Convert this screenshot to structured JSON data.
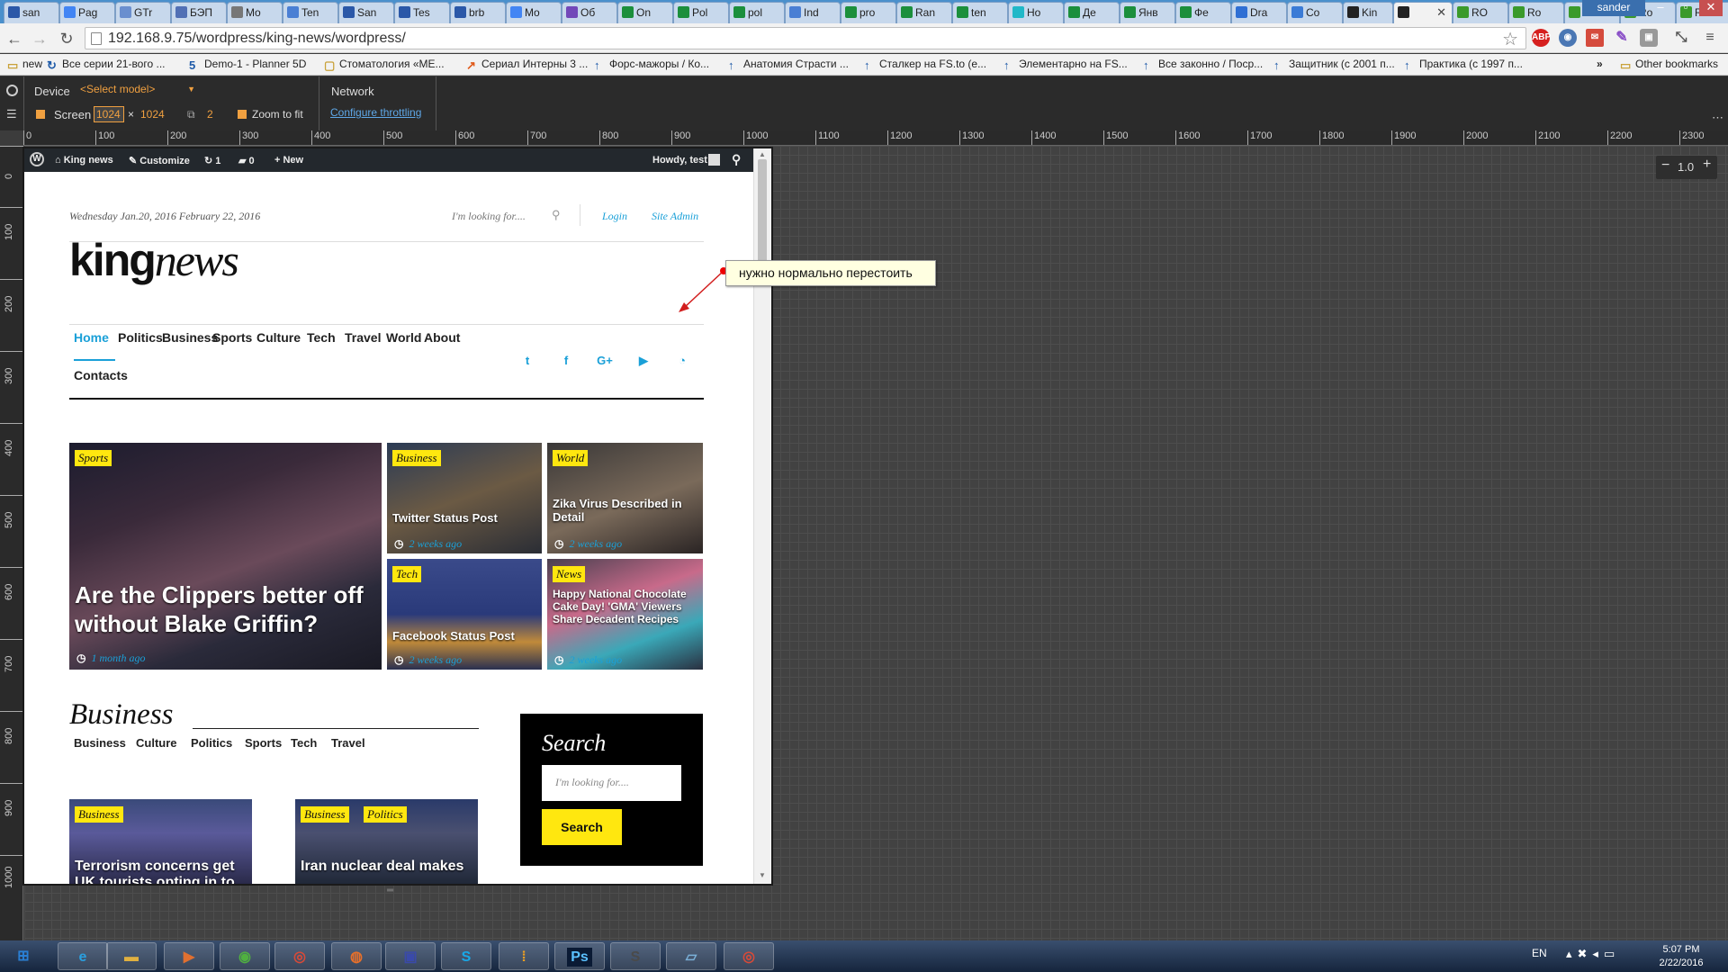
{
  "browser": {
    "tabs": [
      {
        "label": "san",
        "icon": "x-icon"
      },
      {
        "label": "Pag",
        "icon": "g-icon"
      },
      {
        "label": "GTr",
        "icon": "gt-icon"
      },
      {
        "label": "БЭП",
        "icon": "b-icon"
      },
      {
        "label": "Mo",
        "icon": "w-icon"
      },
      {
        "label": "Ten",
        "icon": "doc-icon"
      },
      {
        "label": "San",
        "icon": "x-icon"
      },
      {
        "label": "Tes",
        "icon": "x-icon"
      },
      {
        "label": "brb",
        "icon": "x-icon"
      },
      {
        "label": "Mo",
        "icon": "g-icon"
      },
      {
        "label": "Об",
        "icon": "forms-icon"
      },
      {
        "label": "On",
        "icon": "sheets-icon"
      },
      {
        "label": "Pol",
        "icon": "sheets-icon"
      },
      {
        "label": "pol",
        "icon": "sheets-icon"
      },
      {
        "label": "Ind",
        "icon": "doc-icon"
      },
      {
        "label": "pro",
        "icon": "sheets-icon"
      },
      {
        "label": "Ran",
        "icon": "sheets-icon"
      },
      {
        "label": "ten",
        "icon": "sheets-icon"
      },
      {
        "label": "Ho",
        "icon": "teal-icon"
      },
      {
        "label": "Де",
        "icon": "sheets-icon"
      },
      {
        "label": "Янв",
        "icon": "sheets-icon"
      },
      {
        "label": "Фе",
        "icon": "sheets-icon"
      },
      {
        "label": "Dra",
        "icon": "slides-icon"
      },
      {
        "label": "Co",
        "icon": "q-icon"
      },
      {
        "label": "Kin",
        "icon": "wp-icon"
      },
      {
        "label": "",
        "icon": "wp-icon",
        "active": true
      },
      {
        "label": "RO",
        "icon": "frog-icon"
      },
      {
        "label": "Ro",
        "icon": "frog-icon"
      },
      {
        "label": "Ro",
        "icon": "frog-icon"
      },
      {
        "label": "Ro",
        "icon": "frog-icon"
      },
      {
        "label": "Ro",
        "icon": "frog-icon"
      },
      {
        "label": "Ro",
        "icon": "frog-icon"
      }
    ],
    "user": "sander",
    "url": "192.168.9.75/wordpress/king-news/wordpress/",
    "extensions": [
      "abp-icon",
      "globe-icon",
      "gmail-icon",
      "pen-icon",
      "puzzle-icon",
      "resize-icon",
      "menu-icon"
    ],
    "gmail_badge": "34",
    "bookmarks": [
      {
        "label": "new",
        "icon": "folder-icon"
      },
      {
        "label": "Все серии 21-вого ...",
        "icon": "refresh-icon"
      },
      {
        "label": "Demo-1 - Planner 5D",
        "icon": "5d-icon"
      },
      {
        "label": "Стоматология «МЕ...",
        "icon": "page-icon"
      },
      {
        "label": "Сериал Интерны 3 ...",
        "icon": "rocket-icon"
      },
      {
        "label": "Форс-мажоры / Ко...",
        "icon": "arrow-up-icon"
      },
      {
        "label": "Анатомия Страсти ...",
        "icon": "arrow-up-icon"
      },
      {
        "label": "Сталкер на FS.to (e...",
        "icon": "arrow-up-icon"
      },
      {
        "label": "Элементарно на FS...",
        "icon": "arrow-up-icon"
      },
      {
        "label": "Все законно / Поср...",
        "icon": "arrow-up-icon"
      },
      {
        "label": "Защитник (с 2001 п...",
        "icon": "arrow-up-icon"
      },
      {
        "label": "Практика (с 1997 п...",
        "icon": "arrow-up-icon"
      }
    ],
    "bookmarks_more": "»",
    "other_bookmarks": "Other bookmarks"
  },
  "devtools": {
    "device_label": "Device",
    "model_select": "<Select model>",
    "screen_label": "Screen",
    "screen_width": "1024",
    "screen_height": "1024",
    "times": "×",
    "dpr": "2",
    "zoom_to_fit": "Zoom to fit",
    "network_label": "Network",
    "throttling_link": "Configure throttling",
    "zoom_value": "1.0",
    "hruler_ticks": [
      "0",
      "100",
      "200",
      "300",
      "400",
      "500",
      "600",
      "700",
      "800",
      "900",
      "1000",
      "1100",
      "1200",
      "1300",
      "1400",
      "1500",
      "1600",
      "1700",
      "1800",
      "1900",
      "2000",
      "2100",
      "2200",
      "2300"
    ],
    "vruler_ticks": [
      "0",
      "100",
      "200",
      "300",
      "400",
      "500",
      "600",
      "700",
      "800",
      "900",
      "1000"
    ]
  },
  "wp_admin_bar": {
    "site": "King news",
    "customize": "Customize",
    "updates": "1",
    "comments": "0",
    "new": "New",
    "howdy": "Howdy, test"
  },
  "site": {
    "date": "Wednesday Jan.20, 2016 February 22, 2016",
    "search_placeholder": "I'm looking for....",
    "login": "Login",
    "site_admin": "Site Admin",
    "logo_bold": "king",
    "logo_italic": "news",
    "nav": [
      "Home",
      "Politics",
      "Business",
      "Sports",
      "Culture",
      "Tech",
      "Travel",
      "World",
      "About",
      "Contacts"
    ],
    "social": [
      "twitter-icon",
      "facebook-icon",
      "google-plus-icon",
      "youtube-icon",
      "rss-icon"
    ],
    "featured": [
      {
        "cat": "Sports",
        "title": "Are the Clippers better off without Blake Griffin?",
        "time": "1 month ago"
      },
      {
        "cat": "Business",
        "title": "Twitter Status Post",
        "time": "2 weeks ago"
      },
      {
        "cat": "World",
        "title": "Zika Virus Described in Detail",
        "time": "2 weeks ago"
      },
      {
        "cat": "Tech",
        "title": "Facebook Status Post",
        "time": "2 weeks ago"
      },
      {
        "cat": "News",
        "title": "Happy National Chocolate Cake Day! 'GMA' Viewers Share Decadent Recipes",
        "time": "2 weeks ago"
      }
    ],
    "section_title": "Business",
    "section_tabs": [
      "Business",
      "Culture",
      "Politics",
      "Sports",
      "Tech",
      "Travel"
    ],
    "posts": [
      {
        "cats": [
          "Business"
        ],
        "title": "Terrorism concerns get UK tourists opting in to"
      },
      {
        "cats": [
          "Business",
          "Politics"
        ],
        "title": "Iran nuclear deal makes"
      }
    ],
    "search_widget_title": "Search",
    "search_widget_placeholder": "I'm looking for....",
    "search_widget_button": "Search",
    "accent": "#1aa0d8",
    "badge": "#ffe70f"
  },
  "annotation": "нужно нормально перестоить",
  "taskbar": {
    "apps": [
      "start-icon",
      "ie-icon",
      "explorer-icon",
      "media-icon",
      "disk-icon",
      "chrome-icon",
      "firefox-icon",
      "save-icon",
      "skype-icon",
      "slides-app-icon",
      "photoshop-icon",
      "sublime-icon",
      "notepad-icon",
      "chrome2-icon"
    ],
    "ps_label": "Ps",
    "lang": "EN",
    "time": "5:07 PM",
    "date": "2/22/2016"
  }
}
